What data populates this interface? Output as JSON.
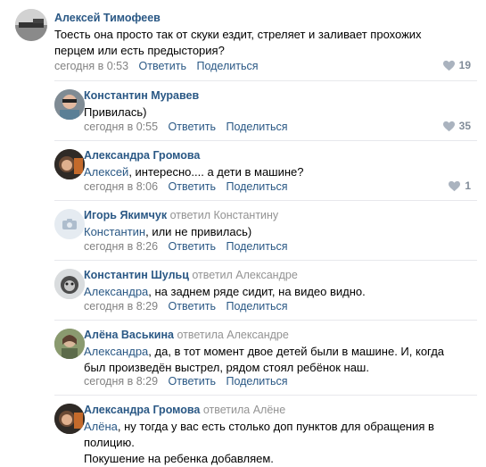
{
  "comments": [
    {
      "author": "Алексей Тимофеев",
      "replied": "",
      "mention": "",
      "text": "Тоесть она просто так от скуки ездит, стреляет и заливает прохожих перцем или есть предыстория?",
      "time": "сегодня в 0:53",
      "reply": "Ответить",
      "share": "Поделиться",
      "likes": "19"
    },
    {
      "author": "Константин Муравев",
      "replied": "",
      "mention": "",
      "text": "Привилась)",
      "time": "сегодня в 0:55",
      "reply": "Ответить",
      "share": "Поделиться",
      "likes": "35"
    },
    {
      "author": "Александра Громова",
      "replied": "",
      "mention": "Алексей",
      "text": ", интересно.... а дети в машине?",
      "time": "сегодня в 8:06",
      "reply": "Ответить",
      "share": "Поделиться",
      "likes": "1"
    },
    {
      "author": "Игорь Якимчук",
      "replied": "ответил Константину",
      "mention": "Константин",
      "text": ", или не привилась)",
      "time": "сегодня в 8:26",
      "reply": "Ответить",
      "share": "Поделиться",
      "likes": ""
    },
    {
      "author": "Константин Шульц",
      "replied": "ответил Александре",
      "mention": "Александра",
      "text": ", на заднем ряде сидит, на видео видно.",
      "time": "сегодня в 8:29",
      "reply": "Ответить",
      "share": "Поделиться",
      "likes": ""
    },
    {
      "author": "Алёна Васькина",
      "replied": "ответила Александре",
      "mention": "Александра",
      "text": ", да, в тот момент двое детей были в машине. И, когда был произведён выстрел, рядом стоял ребёнок наш.",
      "time": "сегодня в 8:29",
      "reply": "Ответить",
      "share": "Поделиться",
      "likes": ""
    },
    {
      "author": "Александра Громова",
      "replied": "ответила Алёне",
      "mention": "Алёна",
      "text": ", ну тогда у вас есть столько доп пунктов для обращения в полицию.",
      "text2": "Покушение на ребенка добавляем.",
      "time": "",
      "reply": "",
      "share": "",
      "likes": ""
    }
  ],
  "colors": {
    "link": "#2a5885",
    "meta": "#828282",
    "like": "#818c99",
    "divider": "#e7e8ec"
  },
  "icons": {
    "like": "heart-icon",
    "no_photo": "camera-icon"
  }
}
